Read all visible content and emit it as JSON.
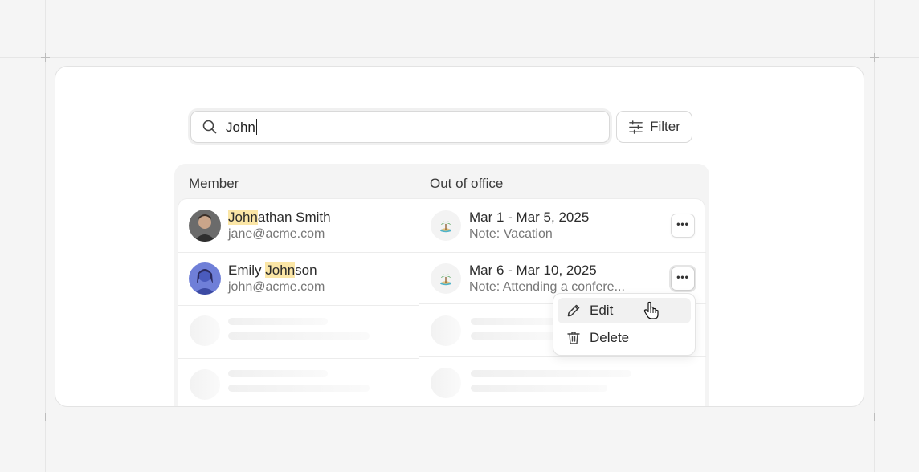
{
  "search": {
    "value": "John"
  },
  "filter": {
    "label": "Filter",
    "icon": "sliders-icon"
  },
  "table": {
    "columns": [
      "Member",
      "Out of office"
    ],
    "rows": [
      {
        "name_match": "John",
        "name_rest": "athan Smith",
        "email": "jane@acme.com",
        "dates": "Mar 1 - Mar 5, 2025",
        "note": "Note: Vacation",
        "icon": "island-icon"
      },
      {
        "name_pre": "Emily ",
        "name_match": "John",
        "name_rest": "son",
        "email": "john@acme.com",
        "dates": "Mar 6 - Mar 10, 2025",
        "note": "Note: Attending a confere...",
        "icon": "island-icon"
      }
    ]
  },
  "menu": {
    "items": [
      {
        "label": "Edit",
        "icon": "pencil-icon"
      },
      {
        "label": "Delete",
        "icon": "trash-icon"
      }
    ]
  },
  "colors": {
    "highlight": "#fbe6a6",
    "background": "#f5f5f5"
  }
}
